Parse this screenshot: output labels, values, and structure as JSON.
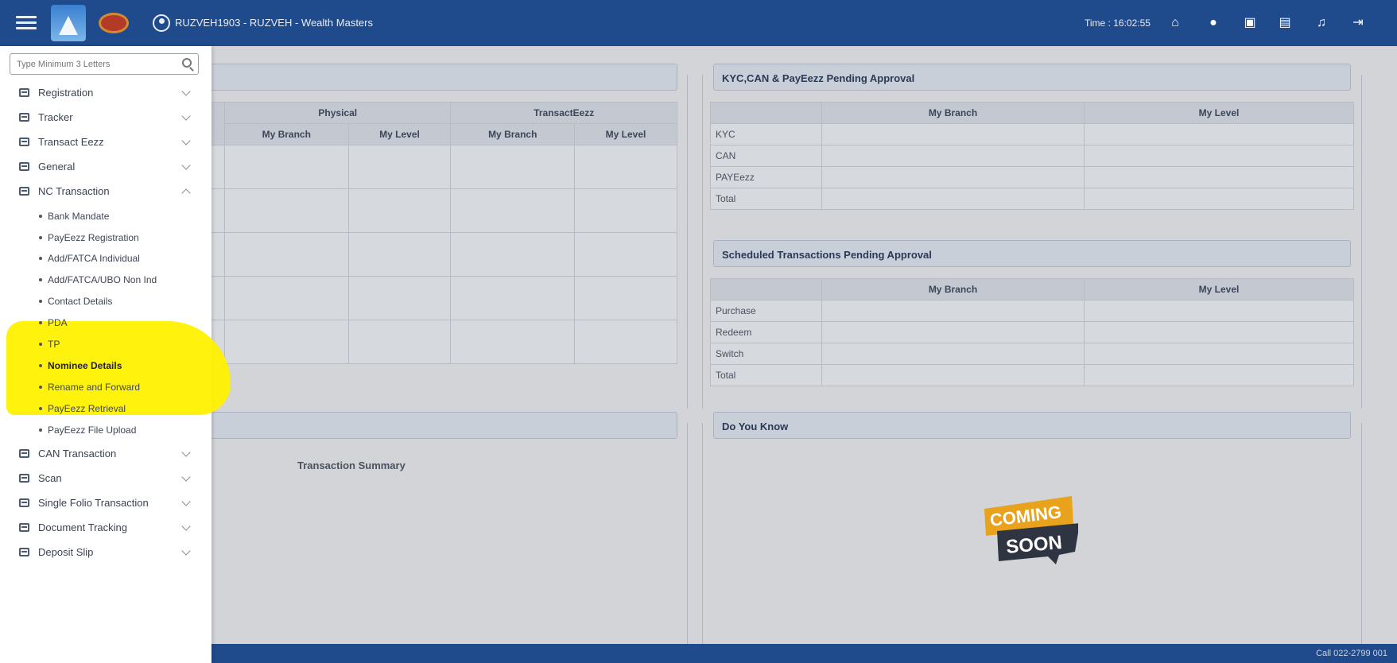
{
  "header": {
    "user": "RUZVEH1903 - RUZVEH - Wealth Masters",
    "time": "Time : 16:02:55"
  },
  "sidebar": {
    "search_placeholder": "Type Minimum 3 Letters",
    "menu": [
      {
        "label": "Registration",
        "expanded": false
      },
      {
        "label": "Tracker",
        "expanded": false
      },
      {
        "label": "Transact Eezz",
        "expanded": false
      },
      {
        "label": "General",
        "expanded": false
      },
      {
        "label": "NC Transaction",
        "expanded": true
      }
    ],
    "nc_sub": [
      "Bank Mandate",
      "PayEezz Registration",
      "Add/FATCA Individual",
      "Add/FATCA/UBO Non Ind",
      "Contact Details",
      "PDA",
      "TP",
      "Nominee Details",
      "Rename and Forward",
      "PayEezz Retrieval",
      "PayEezz File Upload"
    ],
    "menu_after": [
      {
        "label": "CAN Transaction"
      },
      {
        "label": "Scan"
      },
      {
        "label": "Single Folio Transaction"
      },
      {
        "label": "Document Tracking"
      },
      {
        "label": "Deposit Slip"
      }
    ]
  },
  "left_panel": {
    "physical": "Physical",
    "transacteezz": "TransactEezz",
    "my_branch": "My Branch",
    "my_level": "My Level"
  },
  "kyc_panel": {
    "title": "KYC,CAN & PayEezz Pending Approval",
    "my_branch": "My Branch",
    "my_level": "My Level",
    "rows": [
      "KYC",
      "CAN",
      "PAYEezz",
      "Total"
    ]
  },
  "sched_panel": {
    "title": "Scheduled Transactions Pending Approval",
    "my_branch": "My Branch",
    "my_level": "My Level",
    "rows": [
      "Purchase",
      "Redeem",
      "Switch",
      "Total"
    ]
  },
  "summary": {
    "title": "Transaction Summary"
  },
  "know_panel": {
    "title": "Do You Know",
    "badge_top": "COMING",
    "badge_bottom": "SOON"
  },
  "footer": {
    "text": "Call 022-2799 001"
  },
  "colors": {
    "topbar": "#1f4a8c",
    "highlight": "#fff100",
    "badge_orange": "#e8a21c",
    "badge_dark": "#2f3442"
  }
}
